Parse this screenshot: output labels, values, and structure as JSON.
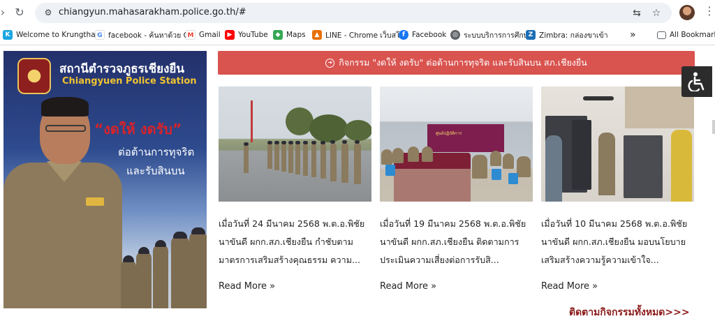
{
  "browser": {
    "url": "chiangyun.mahasarakham.police.go.th/#",
    "bookmarks": [
      {
        "label": "Welcome to Krungtha...",
        "icon": "krungthai-icon",
        "color": "#1ba5e1"
      },
      {
        "label": "facebook - ค้นหาด้วย G...",
        "icon": "google-icon",
        "color": "#4285f4"
      },
      {
        "label": "Gmail",
        "icon": "gmail-icon",
        "color": "#ea4335"
      },
      {
        "label": "YouTube",
        "icon": "youtube-icon",
        "color": "#ff0000"
      },
      {
        "label": "Maps",
        "icon": "maps-icon",
        "color": "#34a853"
      },
      {
        "label": "LINE - Chrome เว็บสโตร์",
        "icon": "line-icon",
        "color": "#e8710a"
      },
      {
        "label": "Facebook",
        "icon": "facebook-icon",
        "color": "#1877f2"
      },
      {
        "label": "ระบบบริการการศึกษา",
        "icon": "globe-icon",
        "color": "#5f6368"
      },
      {
        "label": "Zimbra: กล่องขาเข้า",
        "icon": "zimbra-icon",
        "color": "#1b6fb5"
      }
    ],
    "more_label": "»",
    "all_bookmarks": "All Bookmarks"
  },
  "banner": {
    "title_th": "สถานีตำรวจภูธรเชียงยืน",
    "title_en": "Chiangyuen Police Station",
    "slogan": "“งดให้ งดรับ”",
    "line1": "ต่อต้านการทุจริต",
    "line2": "และรับสินบน",
    "logo_text": "Chiangyuen"
  },
  "activity_bar": {
    "label": "กิจกรรม \"งดให้ งดรับ\" ต่อต้านการทุจริต และรับสินบน สภ.เชียงยืน",
    "color": "#d9534f"
  },
  "posts": [
    {
      "lines": [
        "เมื่อวันที่ 24 มีนาคม 2568 พ.ต.อ.พิชัย",
        "นาขันดี ผกก.สภ.เชียงยืน กำชับตาม",
        "มาตรการเสริมสร้างคุณธรรม ความ..."
      ],
      "read_more": "Read More »"
    },
    {
      "lines": [
        "เมื่อวันที่ 19 มีนาคม 2568 พ.ต.อ.พิชัย",
        "นาขันดี ผกก.สภ.เชียงยืน ติดตามการ",
        "ประเมินความเสี่ยงต่อการรับสิ..."
      ],
      "read_more": "Read More »",
      "photo_sign": "ศูนย์ปฏิบัติการ"
    },
    {
      "lines": [
        "เมื่อวันที่ 10 มีนาคม 2568 พ.ต.อ.พิชัย",
        "นาขันดี ผกก.สภ.เชียงยืน มอบนโยบาย",
        "เสริมสร้างความรู้ความเข้าใจ..."
      ],
      "read_more": "Read More »"
    }
  ],
  "all_activities": "ติดตามกิจกรรมทั้งหมด>>>",
  "accessibility": {
    "icon": "wheelchair-icon"
  }
}
